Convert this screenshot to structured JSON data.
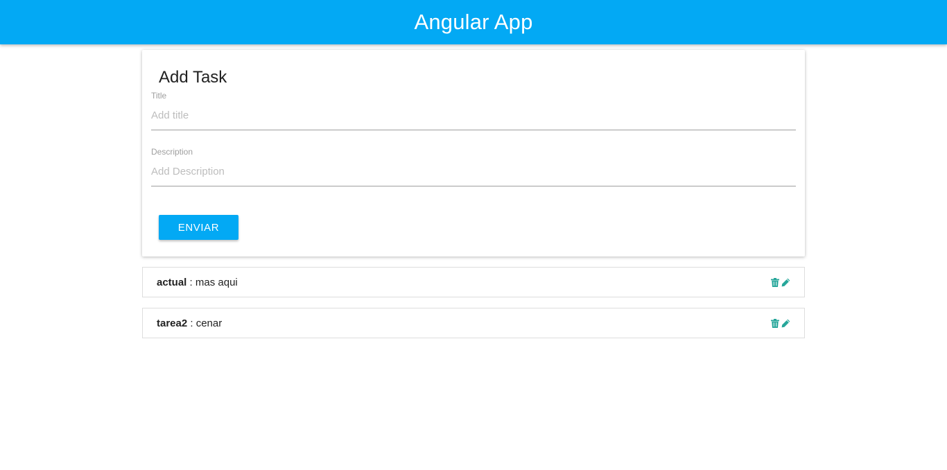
{
  "header": {
    "title": "Angular App"
  },
  "form": {
    "heading": "Add Task",
    "title_label": "Title",
    "title_placeholder": "Add title",
    "description_label": "Description",
    "description_placeholder": "Add Description",
    "submit_label": "ENVIAR"
  },
  "tasks": [
    {
      "title": "actual",
      "separator": " : ",
      "description": "mas aqui",
      "actions": [
        "trash-icon",
        "pencil-icon"
      ]
    },
    {
      "title": "tarea2",
      "separator": " : ",
      "description": "cenar",
      "actions": [
        "trash-icon",
        "pencil-icon"
      ]
    }
  ],
  "colors": {
    "primary": "#03a9f4",
    "icon": "#26a69a",
    "label": "#9e9e9e"
  }
}
